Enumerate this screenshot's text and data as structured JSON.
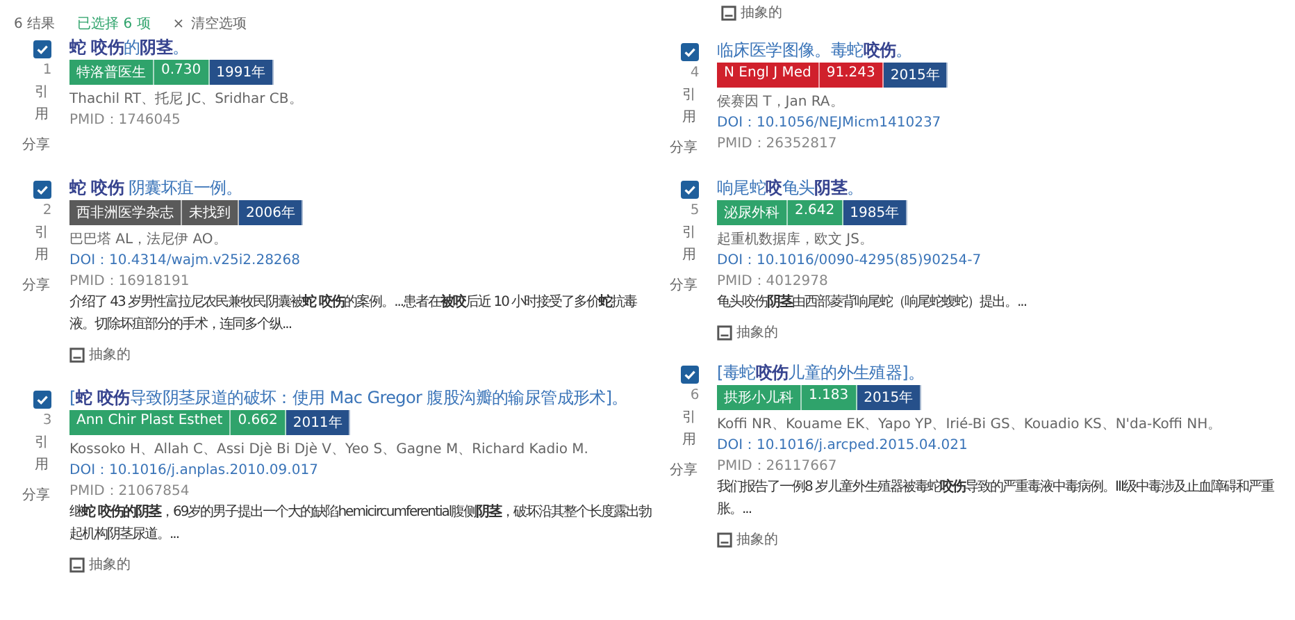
{
  "header": {
    "results": "6 结果",
    "selected_count": "已选择 6 项",
    "clear_icon": "×",
    "clear": "清空选项"
  },
  "top_partial": {
    "abstract_link": "抽象的"
  },
  "columns": [
    {
      "articles": [
        {
          "checked": true,
          "number": "1",
          "title": "**蛇 咬伤**的**阴茎**。",
          "badges": [
            {
              "text": "特洛普医生",
              "color": "#2fa36b"
            },
            {
              "text": "0.730",
              "color": "#2fa36b"
            },
            {
              "text": "1991年",
              "color": "#26508a"
            }
          ],
          "authors": "Thachil RT、托尼 JC、Sridhar CB。",
          "pmid": "PMID：1746045",
          "cite": "引用",
          "share": "分享"
        },
        {
          "checked": true,
          "number": "2",
          "title": "**蛇 咬伤** 阴囊坏疽一例。",
          "badges": [
            {
              "text": "西非洲医学杂志",
              "color": "#5a5a5a"
            },
            {
              "text": "未找到",
              "color": "#5a5a5a"
            },
            {
              "text": "2006年",
              "color": "#26508a"
            }
          ],
          "authors": "巴巴塔 AL，法尼伊 AO。",
          "doi": "DOI：10.4314/wajm.v25i2.28268",
          "pmid": "PMID：16918191",
          "abstract": [
            "介绍了 43 岁男性富拉尼农民兼牧民阴囊被**蛇 咬伤**的案例。...患者在**被咬**后近 10 小时接受了多价**蛇**抗毒",
            "液。切除坏疽部分的手术，连同多个纵..."
          ],
          "abstract_link": "抽象的",
          "cite": "引用",
          "share": "分享"
        },
        {
          "checked": true,
          "number": "3",
          "title": "[**蛇 咬伤**导致阴茎尿道的破坏：使用 Mac Gregor 腹股沟瓣的输尿管成形术]。",
          "badges": [
            {
              "text": "Ann Chir Plast Esthet",
              "color": "#2fa36b"
            },
            {
              "text": "0.662",
              "color": "#2fa36b"
            },
            {
              "text": "2011年",
              "color": "#26508a"
            }
          ],
          "authors": "Kossoko H、Allah C、Assi Djè Bi Djè V、Yeo S、Gagne M、Richard Kadio M.",
          "doi": "DOI：10.1016/j.anplas.2010.09.017",
          "pmid": "PMID：21067854",
          "abstract": [
            "继**蛇 咬伤的阴茎**，69岁的男子提出一个大的缺陷hemicircumferential腹侧**阴茎**，破坏沿其整个长度露出勃",
            "起机构阴茎尿道。..."
          ],
          "abstract_link": "抽象的",
          "cite": "引用",
          "share": "分享"
        }
      ]
    },
    {
      "articles": [
        {
          "checked": true,
          "number": "4",
          "title": "临床医学图像。毒蛇**咬伤**。",
          "badges": [
            {
              "text": "N Engl J Med",
              "color": "#d0202c"
            },
            {
              "text": "91.243",
              "color": "#d0202c"
            },
            {
              "text": "2015年",
              "color": "#26508a"
            }
          ],
          "authors": "侯赛因 T，Jan RA。",
          "doi": "DOI：10.1056/NEJMicm1410237",
          "pmid": "PMID：26352817",
          "cite": "引用",
          "share": "分享"
        },
        {
          "checked": true,
          "number": "5",
          "title": "响尾蛇**咬**龟头**阴茎**。",
          "badges": [
            {
              "text": "泌尿外科",
              "color": "#2fa36b"
            },
            {
              "text": "2.642",
              "color": "#2fa36b"
            },
            {
              "text": "1985年",
              "color": "#26508a"
            }
          ],
          "authors": "起重机数据库，欧文 JS。",
          "doi": "DOI：10.1016/0090-4295(85)90254-7",
          "pmid": "PMID：4012978",
          "abstract": [
            "龟头咬伤**阴茎**由西部菱背响尾蛇（响尾蛇蝮蛇）提出。..."
          ],
          "abstract_link": "抽象的",
          "cite": "引用",
          "share": "分享"
        },
        {
          "checked": true,
          "number": "6",
          "title": "[毒蛇**咬伤**儿童的外生殖器]。",
          "badges": [
            {
              "text": "拱形小儿科",
              "color": "#2fa36b"
            },
            {
              "text": "1.183",
              "color": "#2fa36b"
            },
            {
              "text": "2015年",
              "color": "#26508a"
            }
          ],
          "authors": "Koffi NR、Kouame EK、Yapo YP、Irié-Bi GS、Kouadio KS、N'da-Koffi NH。",
          "doi": "DOI：10.1016/j.arcped.2015.04.021",
          "pmid": "PMID：26117667",
          "abstract": [
            "我们报告了一例8 岁儿童外生殖器被毒蛇**咬伤**导致的严重毒液中毒病例。III级中毒涉及止血障碍和严重",
            "胀。..."
          ],
          "abstract_link": "抽象的",
          "cite": "引用",
          "share": "分享"
        }
      ]
    }
  ]
}
